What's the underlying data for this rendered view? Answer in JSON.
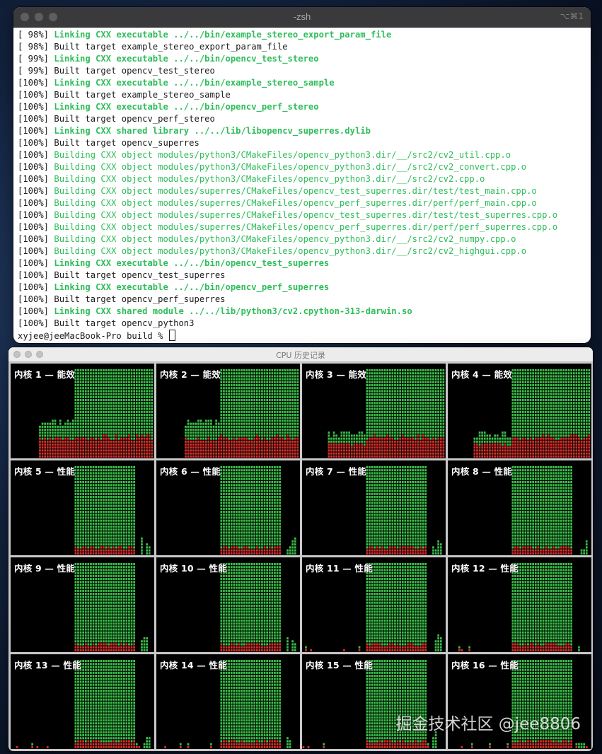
{
  "terminal": {
    "title": "-zsh",
    "shortcut": "⌥⌘1",
    "lines": [
      {
        "pct": "[ 98%]",
        "text": " Linking CXX executable ../../bin/example_stereo_export_param_file",
        "style": "gb"
      },
      {
        "pct": "[ 98%]",
        "text": " Built target example_stereo_export_param_file",
        "style": "plain"
      },
      {
        "pct": "[ 99%]",
        "text": " Linking CXX executable ../../bin/opencv_test_stereo",
        "style": "gb"
      },
      {
        "pct": "[ 99%]",
        "text": " Built target opencv_test_stereo",
        "style": "plain"
      },
      {
        "pct": "[100%]",
        "text": " Linking CXX executable ../../bin/example_stereo_sample",
        "style": "gb"
      },
      {
        "pct": "[100%]",
        "text": " Built target example_stereo_sample",
        "style": "plain"
      },
      {
        "pct": "[100%]",
        "text": " Linking CXX executable ../../bin/opencv_perf_stereo",
        "style": "gb"
      },
      {
        "pct": "[100%]",
        "text": " Built target opencv_perf_stereo",
        "style": "plain"
      },
      {
        "pct": "[100%]",
        "text": " Linking CXX shared library ../../lib/libopencv_superres.dylib",
        "style": "gb"
      },
      {
        "pct": "[100%]",
        "text": " Built target opencv_superres",
        "style": "plain"
      },
      {
        "pct": "[100%]",
        "text": " Building CXX object modules/python3/CMakeFiles/opencv_python3.dir/__/src2/cv2_util.cpp.o",
        "style": "g"
      },
      {
        "pct": "[100%]",
        "text": " Building CXX object modules/python3/CMakeFiles/opencv_python3.dir/__/src2/cv2_convert.cpp.o",
        "style": "g"
      },
      {
        "pct": "[100%]",
        "text": " Building CXX object modules/python3/CMakeFiles/opencv_python3.dir/__/src2/cv2.cpp.o",
        "style": "g"
      },
      {
        "pct": "[100%]",
        "text": " Building CXX object modules/superres/CMakeFiles/opencv_test_superres.dir/test/test_main.cpp.o",
        "style": "g"
      },
      {
        "pct": "[100%]",
        "text": " Building CXX object modules/superres/CMakeFiles/opencv_perf_superres.dir/perf/perf_main.cpp.o",
        "style": "g"
      },
      {
        "pct": "[100%]",
        "text": " Building CXX object modules/superres/CMakeFiles/opencv_test_superres.dir/test/test_superres.cpp.o",
        "style": "g"
      },
      {
        "pct": "[100%]",
        "text": " Building CXX object modules/superres/CMakeFiles/opencv_perf_superres.dir/perf/perf_superres.cpp.o",
        "style": "g"
      },
      {
        "pct": "[100%]",
        "text": " Building CXX object modules/python3/CMakeFiles/opencv_python3.dir/__/src2/cv2_numpy.cpp.o",
        "style": "g"
      },
      {
        "pct": "[100%]",
        "text": " Building CXX object modules/python3/CMakeFiles/opencv_python3.dir/__/src2/cv2_highgui.cpp.o",
        "style": "g"
      },
      {
        "pct": "[100%]",
        "text": " Linking CXX executable ../../bin/opencv_test_superres",
        "style": "gb"
      },
      {
        "pct": "[100%]",
        "text": " Built target opencv_test_superres",
        "style": "plain"
      },
      {
        "pct": "[100%]",
        "text": " Linking CXX executable ../../bin/opencv_perf_superres",
        "style": "gb"
      },
      {
        "pct": "[100%]",
        "text": " Built target opencv_perf_superres",
        "style": "plain"
      },
      {
        "pct": "[100%]",
        "text": " Linking CXX shared module ../../lib/python3/cv2.cpython-313-darwin.so",
        "style": "gb"
      },
      {
        "pct": "[100%]",
        "text": " Built target opencv_python3",
        "style": "plain"
      }
    ],
    "prompt": "xyjee@jeeMacBook-Pro build % "
  },
  "cpu_window": {
    "title": "CPU 历史记录",
    "colors": {
      "user": "#3bbf4a",
      "system": "#d8312b",
      "background": "#000000"
    },
    "cores": [
      {
        "label": "内核 1 — 能效",
        "type": "efficiency"
      },
      {
        "label": "内核 2 — 能效",
        "type": "efficiency"
      },
      {
        "label": "内核 3 — 能效",
        "type": "efficiency"
      },
      {
        "label": "内核 4 — 能效",
        "type": "efficiency"
      },
      {
        "label": "内核 5 — 性能",
        "type": "performance"
      },
      {
        "label": "内核 6 — 性能",
        "type": "performance"
      },
      {
        "label": "内核 7 — 性能",
        "type": "performance"
      },
      {
        "label": "内核 8 — 性能",
        "type": "performance"
      },
      {
        "label": "内核 9 — 性能",
        "type": "performance"
      },
      {
        "label": "内核 10 — 性能",
        "type": "performance"
      },
      {
        "label": "内核 11 — 性能",
        "type": "performance"
      },
      {
        "label": "内核 12 — 性能",
        "type": "performance"
      },
      {
        "label": "内核 13 — 性能",
        "type": "performance"
      },
      {
        "label": "内核 14 — 性能",
        "type": "performance"
      },
      {
        "label": "内核 15 — 性能",
        "type": "performance"
      },
      {
        "label": "内核 16 — 性能",
        "type": "performance"
      }
    ]
  },
  "watermark": "掘金技术社区 @jee8806"
}
